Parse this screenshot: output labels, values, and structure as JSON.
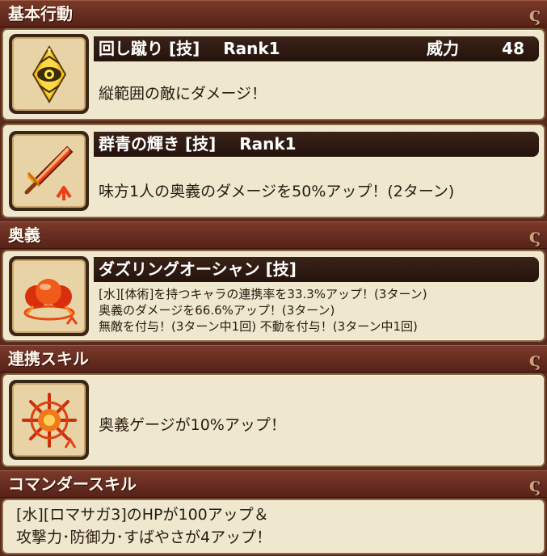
{
  "sections": {
    "basic": "基本行動",
    "ougi": "奥義",
    "renkei": "連携スキル",
    "commander": "コマンダースキル"
  },
  "hook_glyph": "ς",
  "skills": [
    {
      "name": "回し蹴り [技]",
      "rank": "Rank1",
      "power_label": "威力",
      "power": "48",
      "icon": "kick-eye-icon",
      "desc": "縦範囲の敵にダメージ！"
    },
    {
      "name": "群青の輝き [技]",
      "rank": "Rank1",
      "icon": "flaming-sword-icon",
      "desc": "味方1人の奥義のダメージを50%アップ！(2ターン)"
    }
  ],
  "ougi": {
    "name": "ダズリングオーシャン [技]",
    "icon": "fiery-orbs-icon",
    "lines": [
      "[水][体術]を持つキャラの連携率を33.3%アップ！(3ターン)",
      "奥義のダメージを66.6%アップ！(3ターン)",
      "無敵を付与！(3ターン中1回) 不動を付与！(3ターン中1回)"
    ]
  },
  "renkei": {
    "icon": "starburst-icon",
    "desc": "奥義ゲージが10%アップ！"
  },
  "commander": {
    "lines": [
      "[水][ロマサガ3]のHPが100アップ＆",
      "攻撃力･防御力･すばやさが4アップ！"
    ]
  },
  "colors": {
    "header": "#6a2e22",
    "card": "#efe8cf",
    "titlebar": "#2b170f"
  }
}
